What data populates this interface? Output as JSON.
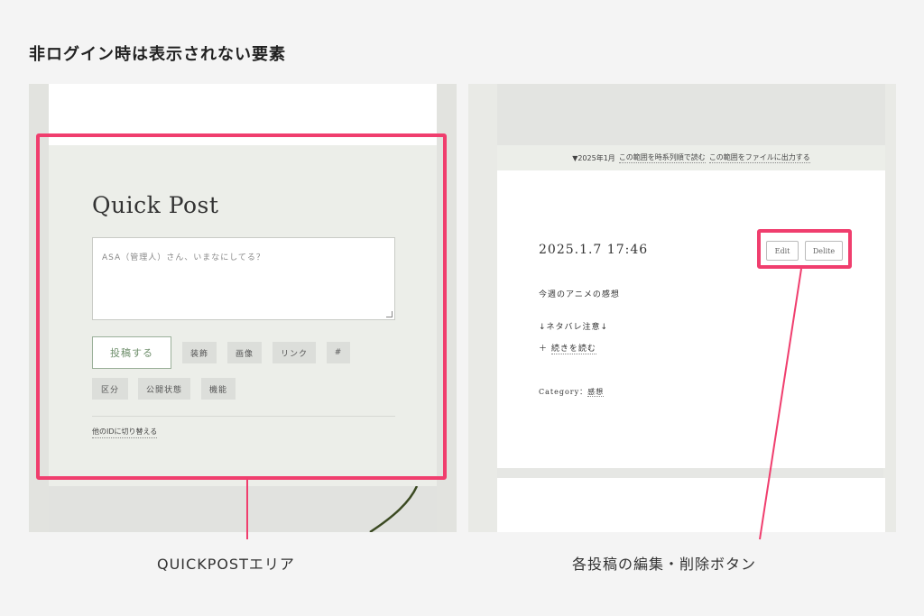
{
  "heading": "非ログイン時は表示されない要素",
  "left": {
    "quickpost": {
      "title": "Quick Post",
      "placeholder": "ASA（管理人）さん、いまなにしてる？",
      "post_button": "投稿する",
      "chips": [
        "装飾",
        "画像",
        "リンク",
        "#",
        "区分",
        "公開状態",
        "機能"
      ],
      "switch_id_link": "他のIDに切り替える"
    },
    "caption": "QUICKPOSTエリア"
  },
  "right": {
    "range_bar": {
      "month": "▼2025年1月",
      "link1": "この範囲を時系列順で読む",
      "link2": "この範囲をファイルに出力する"
    },
    "post": {
      "date": "2025.1.7 17:46",
      "edit_button": "Edit",
      "delete_button": "Delite",
      "line1": "今週のアニメの感想",
      "line2": "↓ネタバレ注意↓",
      "read_more_prefix": "＋",
      "read_more": "続きを読む",
      "category_label": "Category：",
      "category_value": "感想"
    },
    "caption": "各投稿の編集・削除ボタン"
  },
  "colors": {
    "highlight": "#f03e6e",
    "post_button_text": "#6f8f6c",
    "background": "#f4f4f4"
  }
}
